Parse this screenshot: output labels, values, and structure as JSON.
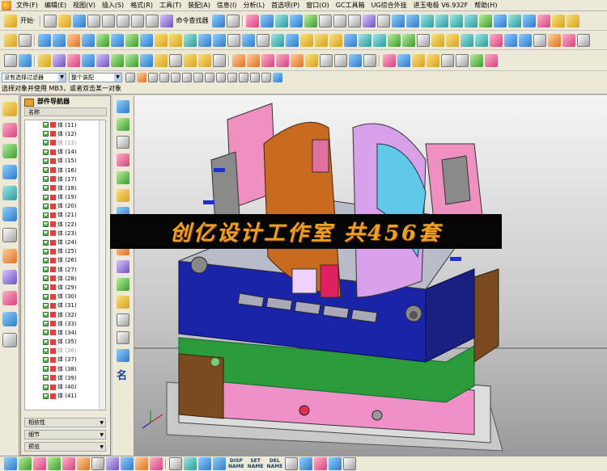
{
  "menubar": {
    "items": [
      "文件(F)",
      "编辑(E)",
      "视图(V)",
      "插入(S)",
      "格式(R)",
      "工具(T)",
      "装配(A)",
      "信息(I)",
      "分析(L)",
      "首选项(P)",
      "窗口(O)",
      "GC工具箱",
      "UG综合外挂",
      "进玉电极 V6.932F",
      "帮助(H)"
    ]
  },
  "toolbar1": {
    "start_label": "开始·",
    "command_finder_label": "命令查找器"
  },
  "filterbar": {
    "type_filter": "没有选择过滤器",
    "scope": "整个装配"
  },
  "status": {
    "prompt": "选择对象并使用 MB3，或者双击某一对象"
  },
  "navigator": {
    "title": "部件导航器",
    "column_name": "名称",
    "rows": [
      {
        "label": "体 (11)",
        "dim": false
      },
      {
        "label": "体 (12)",
        "dim": false
      },
      {
        "label": "体 (13)",
        "dim": true
      },
      {
        "label": "体 (14)",
        "dim": false
      },
      {
        "label": "体 (15)",
        "dim": false
      },
      {
        "label": "体 (16)",
        "dim": false
      },
      {
        "label": "体 (17)",
        "dim": false
      },
      {
        "label": "体 (18)",
        "dim": false
      },
      {
        "label": "体 (19)",
        "dim": false
      },
      {
        "label": "体 (20)",
        "dim": false
      },
      {
        "label": "体 (21)",
        "dim": false
      },
      {
        "label": "体 (22)",
        "dim": false
      },
      {
        "label": "体 (23)",
        "dim": false
      },
      {
        "label": "体 (24)",
        "dim": false
      },
      {
        "label": "体 (25)",
        "dim": false
      },
      {
        "label": "体 (26)",
        "dim": false
      },
      {
        "label": "体 (27)",
        "dim": false
      },
      {
        "label": "体 (28)",
        "dim": false
      },
      {
        "label": "体 (29)",
        "dim": false
      },
      {
        "label": "体 (30)",
        "dim": false
      },
      {
        "label": "体 (31)",
        "dim": false
      },
      {
        "label": "体 (32)",
        "dim": false
      },
      {
        "label": "体 (33)",
        "dim": false
      },
      {
        "label": "体 (34)",
        "dim": false
      },
      {
        "label": "体 (35)",
        "dim": false
      },
      {
        "label": "体 (36)",
        "dim": true
      },
      {
        "label": "体 (37)",
        "dim": false
      },
      {
        "label": "体 (38)",
        "dim": false
      },
      {
        "label": "体 (39)",
        "dim": false
      },
      {
        "label": "体 (40)",
        "dim": false
      },
      {
        "label": "体 (41)",
        "dim": false
      }
    ],
    "sections": [
      "相依性",
      "细节",
      "预览"
    ]
  },
  "viewport": {
    "watermark": "创亿设计工作室 共456套"
  },
  "bottombar": {
    "labels": [
      {
        "top": "DISP",
        "bottom": "NAME"
      },
      {
        "top": "SET",
        "bottom": "NAME"
      },
      {
        "top": "DEL",
        "bottom": "NAME"
      }
    ]
  },
  "rightstrip": {
    "name_label": "名"
  }
}
